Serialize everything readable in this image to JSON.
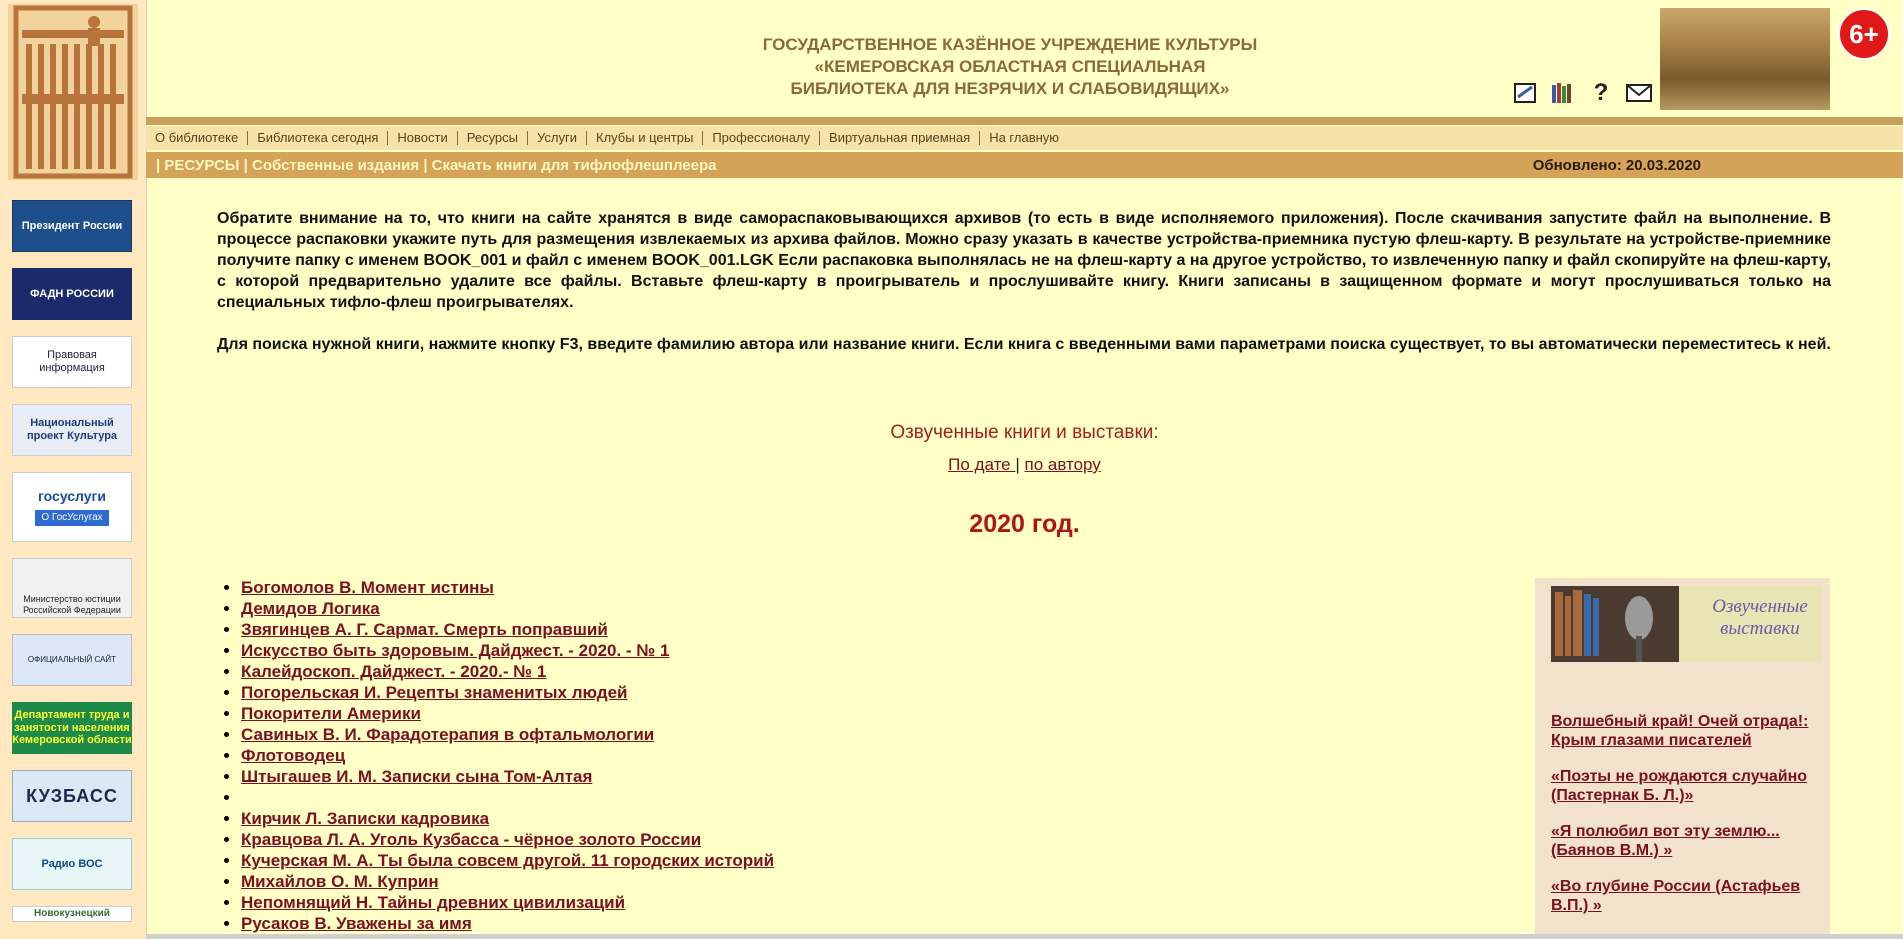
{
  "header": {
    "title_lines": [
      "ГОСУДАРСТВЕННОЕ КАЗЁННОЕ УЧРЕЖДЕНИЕ КУЛЬТУРЫ",
      "«КЕМЕРОВСКАЯ ОБЛАСТНАЯ СПЕЦИАЛЬНАЯ",
      "БИБЛИОТЕКА ДЛЯ НЕЗРЯЧИХ И СЛАБОВИДЯЩИХ»"
    ],
    "age_badge": "6+",
    "icons": [
      "sitemap-icon",
      "books-icon",
      "help-icon",
      "mail-icon"
    ]
  },
  "nav": {
    "items": [
      "О библиотеке",
      "Библиотека сегодня",
      "Новости",
      "Ресурсы",
      "Услуги",
      "Клубы и центры",
      "Профессионалу",
      "Виртуальная приемная",
      "На главную"
    ]
  },
  "subnav": {
    "breadcrumb": "| РЕСУРСЫ | Собственные издания | Скачать книги для тифлофлешплеера",
    "updated": "Обновлено: 20.03.2020"
  },
  "sidebar": {
    "banners": [
      "Президент России",
      "ФАДН РОССИИ",
      "Правовая информация",
      "Национальный проект Культура",
      "госуслуги",
      "О ГосУслугах",
      "Министерство юстиции Российской Федерации",
      "ОФИЦИАЛЬНЫЙ САЙТ",
      "Департамент труда и занятости населения Кемеровской области",
      "КУЗБАСС",
      "Радио ВОС",
      "Новокузнецкий"
    ]
  },
  "intro": {
    "p1": "Обратите внимание на то, что книги на сайте хранятся в виде самораспаковывающихся архивов (то есть в виде исполняемого приложения). После скачивания запустите файл на выполнение. В процессе распаковки укажите путь для размещения извлекаемых из архива файлов. Можно сразу указать в качестве устройства-приемника пустую флеш-карту. В результате на устройстве-приемнике получите папку с именем BOOK_001 и файл с именем BOOK_001.LGK Если распаковка выполнялась не на флеш-карту а на другое устройство, то извлеченную папку и файл скопируйте на флеш-карту, с которой предварительно удалите все файлы. Вставьте флеш-карту в проигрыватель и прослушивайте книгу. Книги записаны в защищенном формате и могут прослушиваться только на специальных тифло-флеш проигрывателях.",
    "p2": "Для поиска нужной книги, нажмите кнопку F3, введите фамилию автора или название книги. Если книга с введенными вами параметрами поиска существует, то вы автоматически переместитесь к ней."
  },
  "voice": {
    "heading": "Озвученные книги и выставки:",
    "by_date": "По дате ",
    "separator": "|",
    "by_author": "по автору"
  },
  "year": "2020 год.",
  "books": [
    "Богомолов В. Момент истины",
    "Демидов Логика",
    "Звягинцев А. Г. Сармат. Смерть поправший",
    "Искусство быть здоровым. Дайджест. - 2020. - № 1",
    "Калейдоскоп. Дайджест. - 2020.- № 1",
    "Погорельская И. Рецепты знаменитых людей",
    "Покорители Америки",
    "Савиных В. И. Фарадотерапия в офтальмологии",
    "Флотоводец",
    "Штыгашев И. М. Записки сына Том-Алтая",
    "",
    "Кирчик Л. Записки кадровика",
    "Кравцова Л. А. Уголь Кузбасса - чёрное золото России",
    "Кучерская М. А. Ты была совсем другой. 11 городских историй",
    "Михайлов О. М. Куприн",
    "Непомнящий Н. Тайны древних цивилизаций",
    "Русаков В. Уважены за имя"
  ],
  "panel": {
    "caption": "Озвученные выставки",
    "links": [
      "Волшебный край! Очей отрада!: Крым глазами писателей",
      "«Поэты не рождаются случайно (Пастернак Б. Л.)»",
      "«Я полюбил вот эту землю... (Баянов В.М.) »",
      "«Во глубине России (Астафьев В.П.) »"
    ]
  }
}
